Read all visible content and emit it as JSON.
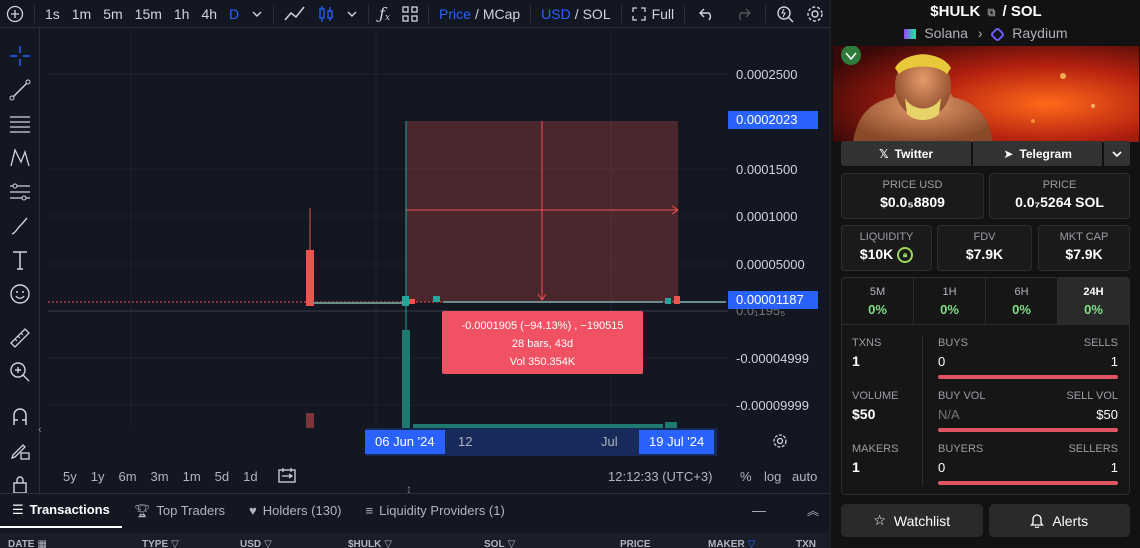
{
  "toolbar": {
    "timeframes": [
      "1s",
      "1m",
      "5m",
      "15m",
      "1h",
      "4h",
      "D"
    ],
    "price_label": "Price",
    "mcap_label": "MCap",
    "usd_label": "USD",
    "sol_label": "SOL",
    "full_label": "Full",
    "slash": "/"
  },
  "chart": {
    "price_ticks": [
      "0.0002500",
      "0.0001500",
      "0.0001000",
      "0.00005000",
      "-0.00004999",
      "-0.00009999"
    ],
    "partial_tick": "0.0₁195₅",
    "price_tags": [
      "0.0002023",
      "0.00001187"
    ],
    "time_labels": [
      "12",
      "Jul"
    ],
    "time_tags": [
      "06 Jun '24",
      "19 Jul '24"
    ],
    "measure": {
      "line1": "-0.0001905 (−94.13%) , −190515",
      "line2": "28 bars, 43d",
      "line3": "Vol 350.354K"
    },
    "colors": {
      "up": "#26a69a",
      "down": "#ef5350",
      "accent": "#2962ff",
      "measure": "#f05264"
    }
  },
  "bottom_bar": {
    "ranges": [
      "5y",
      "1y",
      "6m",
      "3m",
      "1m",
      "5d",
      "1d"
    ],
    "clock": "12:12:33 (UTC+3)",
    "percent": "%",
    "log": "log",
    "auto": "auto"
  },
  "tabs": [
    {
      "label": "Transactions",
      "icon": "list-icon",
      "active": true
    },
    {
      "label": "Top Traders",
      "icon": "trophy-icon",
      "active": false
    },
    {
      "label": "Holders (130)",
      "icon": "heart-icon",
      "active": false
    },
    {
      "label": "Liquidity Providers (1)",
      "icon": "lines-icon",
      "active": false
    }
  ],
  "table_headers": [
    "DATE",
    "TYPE",
    "USD",
    "$HULK",
    "SOL",
    "PRICE",
    "MAKER",
    "TXN"
  ],
  "pair": {
    "base": "$HULK",
    "sep": "/",
    "quote": "SOL",
    "chain": "Solana",
    "dex": "Raydium"
  },
  "social": {
    "twitter": "Twitter",
    "telegram": "Telegram"
  },
  "stats": {
    "price_usd": {
      "label": "PRICE USD",
      "value": "$0.0₅8809"
    },
    "price_sol": {
      "label": "PRICE",
      "value": "0.0₇5264 SOL"
    },
    "liquidity": {
      "label": "LIQUIDITY",
      "value": "$10K"
    },
    "fdv": {
      "label": "FDV",
      "value": "$7.9K"
    },
    "mkt_cap": {
      "label": "MKT CAP",
      "value": "$7.9K"
    }
  },
  "changes": [
    {
      "name": "5M",
      "value": "0%"
    },
    {
      "name": "1H",
      "value": "0%"
    },
    {
      "name": "6H",
      "value": "0%"
    },
    {
      "name": "24H",
      "value": "0%"
    }
  ],
  "activity": {
    "txns": {
      "label": "TXNS",
      "value": "1"
    },
    "buys_sells": {
      "left_label": "BUYS",
      "right_label": "SELLS",
      "left": "0",
      "right": "1"
    },
    "volume": {
      "label": "VOLUME",
      "value": "$50"
    },
    "vol_split": {
      "left_label": "BUY VOL",
      "right_label": "SELL VOL",
      "left": "N/A",
      "right": "$50"
    },
    "makers": {
      "label": "MAKERS",
      "value": "1"
    },
    "buyers_sellers": {
      "left_label": "BUYERS",
      "right_label": "SELLERS",
      "left": "0",
      "right": "1"
    }
  },
  "actions": {
    "watchlist": "Watchlist",
    "alerts": "Alerts"
  }
}
